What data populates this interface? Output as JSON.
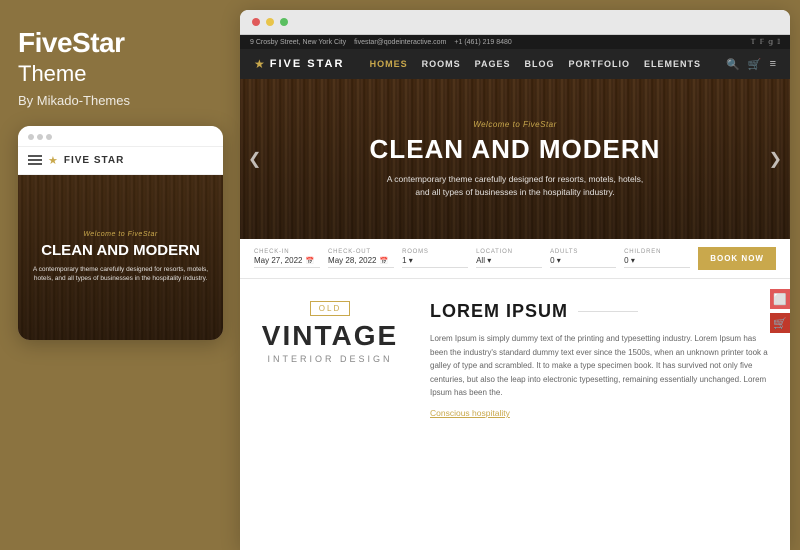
{
  "left": {
    "brand": "FiveStar",
    "subtitle": "Theme",
    "by_label": "By Mikado-Themes",
    "dots": [
      "dot1",
      "dot2",
      "dot3"
    ],
    "mobile": {
      "welcome": "Welcome to FiveStar",
      "headline": "CLEAN AND MODERN",
      "subtext": "A contemporary theme carefully designed for resorts, motels, hotels, and all types of businesses in the hospitality industry.",
      "logo_star": "★",
      "logo_text": "FIVE STAR"
    }
  },
  "browser": {
    "dots": [
      "red",
      "yellow",
      "green"
    ]
  },
  "site": {
    "topbar": {
      "address": "9 Crosby Street, New York City",
      "email": "fivestar@qodeinteractive.com",
      "phone": "+1 (461) 219 8480",
      "socials": [
        "𝕋",
        "𝔽",
        "𝔾+",
        "𝕀"
      ]
    },
    "nav": {
      "star": "★",
      "logo": "FIVE STAR",
      "links": [
        "HOMES",
        "ROOMS",
        "PAGES",
        "BLOG",
        "PORTFOLIO",
        "ELEMENTS"
      ],
      "active_link": "HOMES",
      "actions": [
        "🔍",
        "🛒",
        "≡"
      ]
    },
    "hero": {
      "welcome": "Welcome to FiveStar",
      "headline": "CLEAN AND MODERN",
      "subtext": "A contemporary theme carefully designed for resorts, motels, hotels,\nand all types of businesses in the hospitality industry.",
      "prev": "❮",
      "next": "❯"
    },
    "booking": {
      "fields": [
        {
          "label": "CHECK-IN",
          "value": "May 27, 2022",
          "icon": "📅"
        },
        {
          "label": "CHECK-OUT",
          "value": "May 28, 2022",
          "icon": "📅"
        },
        {
          "label": "ROOMS",
          "value": "1"
        },
        {
          "label": "LOCATION",
          "value": "All"
        },
        {
          "label": "ADULTS",
          "value": "0"
        },
        {
          "label": "CHILDREN",
          "value": "0"
        }
      ],
      "button": "BOOK NOW"
    },
    "content": {
      "vintage_badge": "OLD",
      "vintage_title": "VINTAGE",
      "vintage_sub": "INTERIOR DESIGN",
      "heading": "LOREM IPSUM",
      "body": "Lorem Ipsum is simply dummy text of the printing and typesetting industry. Lorem Ipsum has been the industry's standard dummy text ever since the 1500s, when an unknown printer took a galley of type and scrambled. It to make a type specimen book. It has survived not only five centuries, but also the leap into electronic typesetting, remaining essentially unchanged. Lorem Ipsum has been the.",
      "link": "Conscious hospitality"
    }
  }
}
